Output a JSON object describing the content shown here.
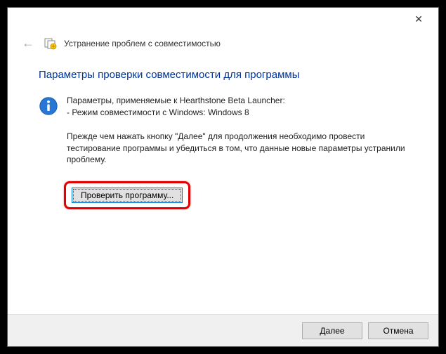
{
  "titlebar": {
    "close_tooltip": "Close"
  },
  "header": {
    "title": "Устранение проблем с совместимостью"
  },
  "page": {
    "title": "Параметры проверки совместимости для программы",
    "info_line1": "Параметры, применяемые к Hearthstone Beta Launcher:",
    "info_line2": "- Режим совместимости с Windows: Windows 8",
    "instruction": "Прежде чем нажать кнопку \"Далее\" для продолжения необходимо провести тестирование программы и убедиться в том, что данные новые параметры устранили проблему.",
    "test_button": "Проверить программу..."
  },
  "footer": {
    "next": "Далее",
    "cancel": "Отмена"
  }
}
